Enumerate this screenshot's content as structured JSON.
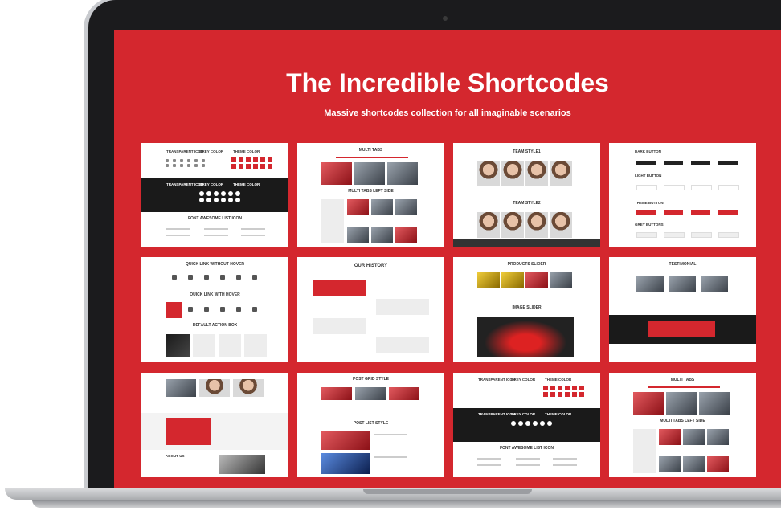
{
  "hero": {
    "title": "The Incredible Shortcodes",
    "subtitle": "Massive shortcodes collection for all imaginable scenarios"
  },
  "cards": {
    "c1": {
      "label1": "TRANSPARENT ICON",
      "label2": "GREY COLOR",
      "label3": "THEME COLOR",
      "title": "FONT AWESOME LIST ICON"
    },
    "c2": {
      "title": "MULTI TABS",
      "subtitle": "MULTI TABS LEFT SIDE"
    },
    "c3": {
      "title": "TEAM STYLE1",
      "subtitle": "TEAM STYLE2"
    },
    "c4": {
      "b1": "DARK BUTTON",
      "b2": "LIGHT BUTTON",
      "b3": "THEME BUTTON",
      "b4": "GREY BUTTONS"
    },
    "c5": {
      "title": "QUICK LINK WITHOUT HOVER",
      "subtitle": "QUICK LINK WITH HOVER",
      "third": "DEFAULT ACTION BOX"
    },
    "c6": {
      "title": "OUR HISTORY"
    },
    "c7": {
      "title": "PRODUCTS SLIDER",
      "subtitle": "IMAGE SLIDER"
    },
    "c8": {
      "title": "TESTIMONIAL"
    },
    "c9": {
      "title": "ABOUT US"
    },
    "c10": {
      "title": "POST GRID STYLE",
      "subtitle": "POST LIST STYLE"
    },
    "c11": {
      "label1": "TRANSPARENT ICON",
      "label2": "GREY COLOR",
      "label3": "THEME COLOR",
      "title": "FONT AWESOME LIST ICON"
    },
    "c12": {
      "title": "MULTI TABS",
      "subtitle": "MULTI TABS LEFT SIDE"
    }
  },
  "colors": {
    "brand_red": "#d4272e",
    "bezel": "#1b1b1d"
  }
}
